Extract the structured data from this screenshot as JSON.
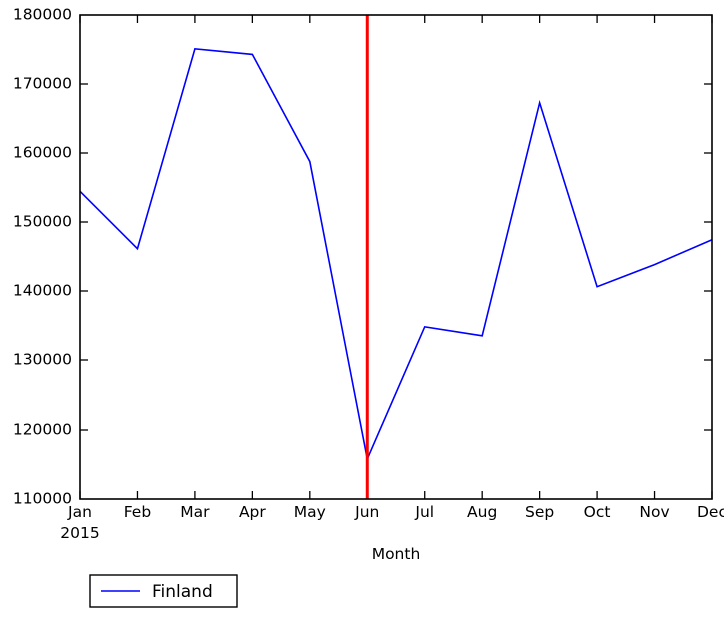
{
  "chart_data": {
    "type": "line",
    "title": "",
    "xlabel": "Month",
    "ylabel": "",
    "categories": [
      "Jan",
      "Feb",
      "Mar",
      "Apr",
      "May",
      "Jun",
      "Jul",
      "Aug",
      "Sep",
      "Oct",
      "Nov",
      "Dec"
    ],
    "x_axis_period_label": "2015",
    "series": [
      {
        "name": "Finland",
        "color": "#0000FF",
        "values": [
          154500,
          146200,
          175100,
          174300,
          158800,
          115800,
          134900,
          133600,
          167300,
          140700,
          143900,
          147500
        ]
      }
    ],
    "ylim": [
      110000,
      180000
    ],
    "ytick_labels": [
      "110000",
      "120000",
      "130000",
      "140000",
      "150000",
      "160000",
      "170000",
      "180000"
    ],
    "ytick_values": [
      110000,
      120000,
      130000,
      140000,
      150000,
      160000,
      170000,
      180000
    ],
    "grid": false,
    "legend": {
      "position": "below-left",
      "entries": [
        {
          "label": "Finland",
          "color": "#0000FF"
        }
      ]
    },
    "annotations": [
      {
        "type": "vertical-line",
        "at_category": "Jun",
        "color": "#FF0000",
        "width": 3
      }
    ]
  }
}
